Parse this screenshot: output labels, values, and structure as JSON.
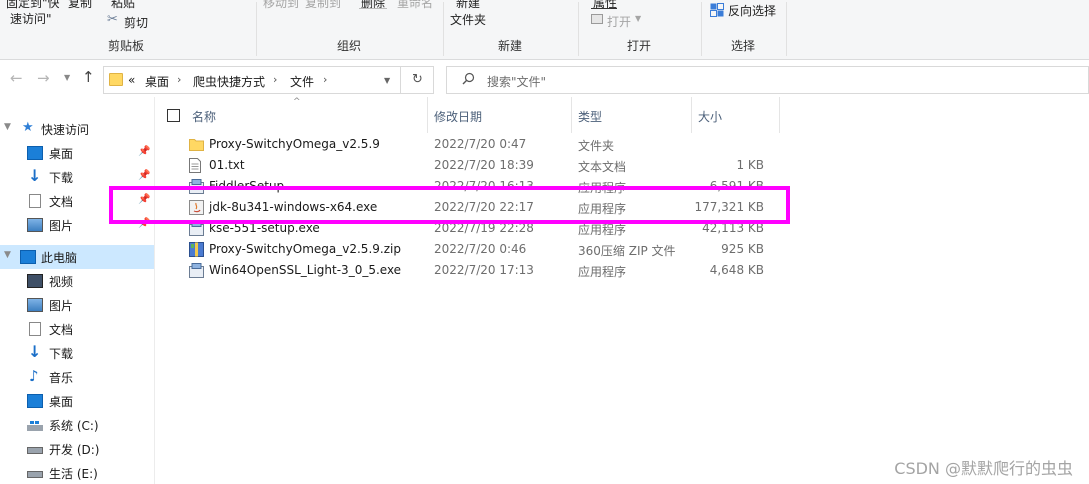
{
  "ribbon": {
    "clipboard": {
      "pin_label_line1": "固定到\"快",
      "pin_label_line2": "速访问\"",
      "copy": "复制",
      "paste": "粘贴",
      "cut": "剪切",
      "group_label": "剪贴板"
    },
    "organize": {
      "move_to": "移动到",
      "copy_to": "复制到",
      "delete": "删除",
      "rename": "重命名",
      "group_label": "组织"
    },
    "new": {
      "new_line1": "新建",
      "new_line2": "文件夹",
      "group_label": "新建"
    },
    "open": {
      "properties": "属性",
      "open": "打开",
      "group_label": "打开"
    },
    "select": {
      "invert": "反向选择",
      "group_label": "选择"
    }
  },
  "address": {
    "overflow": "«",
    "crumbs": [
      "桌面",
      "爬虫快捷方式",
      "文件"
    ],
    "search_placeholder": "搜索\"文件\""
  },
  "nav": {
    "quick_access": "快速访问",
    "quick_items": [
      "桌面",
      "下载",
      "文档",
      "图片"
    ],
    "this_pc": "此电脑",
    "pc_items": [
      "视频",
      "图片",
      "文档",
      "下载",
      "音乐",
      "桌面",
      "系统 (C:)",
      "开发 (D:)",
      "生活 (E:)"
    ]
  },
  "columns": {
    "name": "名称",
    "date": "修改日期",
    "type": "类型",
    "size": "大小"
  },
  "files": [
    {
      "name": "Proxy-SwitchyOmega_v2.5.9",
      "date": "2022/7/20 0:47",
      "type": "文件夹",
      "size": "",
      "icon": "folder-icon"
    },
    {
      "name": "01.txt",
      "date": "2022/7/20 18:39",
      "type": "文本文档",
      "size": "1 KB",
      "icon": "text-file-icon"
    },
    {
      "name": "FiddlerSetup",
      "date": "2022/7/20 16:13",
      "type": "应用程序",
      "size": "6,591 KB",
      "icon": "installer-icon"
    },
    {
      "name": "jdk-8u341-windows-x64.exe",
      "date": "2022/7/20 22:17",
      "type": "应用程序",
      "size": "177,321 KB",
      "icon": "java-installer-icon"
    },
    {
      "name": "kse-551-setup.exe",
      "date": "2022/7/19 22:28",
      "type": "应用程序",
      "size": "42,113 KB",
      "icon": "installer-icon"
    },
    {
      "name": "Proxy-SwitchyOmega_v2.5.9.zip",
      "date": "2022/7/20 0:46",
      "type": "360压缩 ZIP 文件",
      "size": "925 KB",
      "icon": "zip-archive-icon"
    },
    {
      "name": "Win64OpenSSL_Light-3_0_5.exe",
      "date": "2022/7/20 17:13",
      "type": "应用程序",
      "size": "4,648 KB",
      "icon": "installer-icon"
    }
  ],
  "watermark": "CSDN @默默爬行的虫虫",
  "colors": {
    "highlight": "#ff00ff",
    "header_text": "#4c607a",
    "selected_nav": "#cce8ff"
  }
}
